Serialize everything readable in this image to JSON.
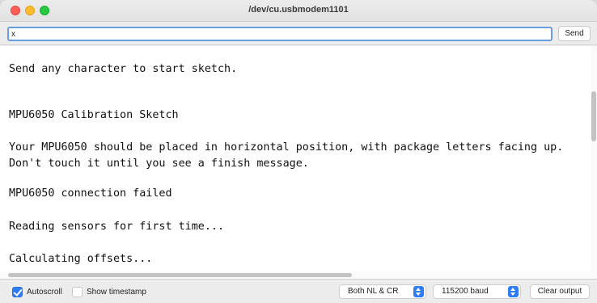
{
  "window": {
    "title": "/dev/cu.usbmodem1101"
  },
  "send": {
    "input_value": "x",
    "button_label": "Send"
  },
  "output": {
    "lines": [
      "Send any character to start sketch.",
      "MPU6050 Calibration Sketch",
      "Your MPU6050 should be placed in horizontal position, with package letters facing up.",
      "Don't touch it until you see a finish message.",
      "MPU6050 connection failed",
      "Reading sensors for first time...",
      "Calculating offsets..."
    ]
  },
  "statusbar": {
    "autoscroll_label": "Autoscroll",
    "autoscroll_checked": true,
    "timestamp_label": "Show timestamp",
    "timestamp_checked": false,
    "line_ending": "Both NL & CR",
    "baud_rate": "115200 baud",
    "clear_label": "Clear output"
  },
  "colors": {
    "accent": "#2f7df6",
    "close": "#ff5f57",
    "minimize": "#febc2e",
    "maximize": "#28c840"
  },
  "icons": [
    "close-icon",
    "minimize-icon",
    "maximize-icon",
    "checkmark-icon",
    "select-arrows-icon"
  ]
}
